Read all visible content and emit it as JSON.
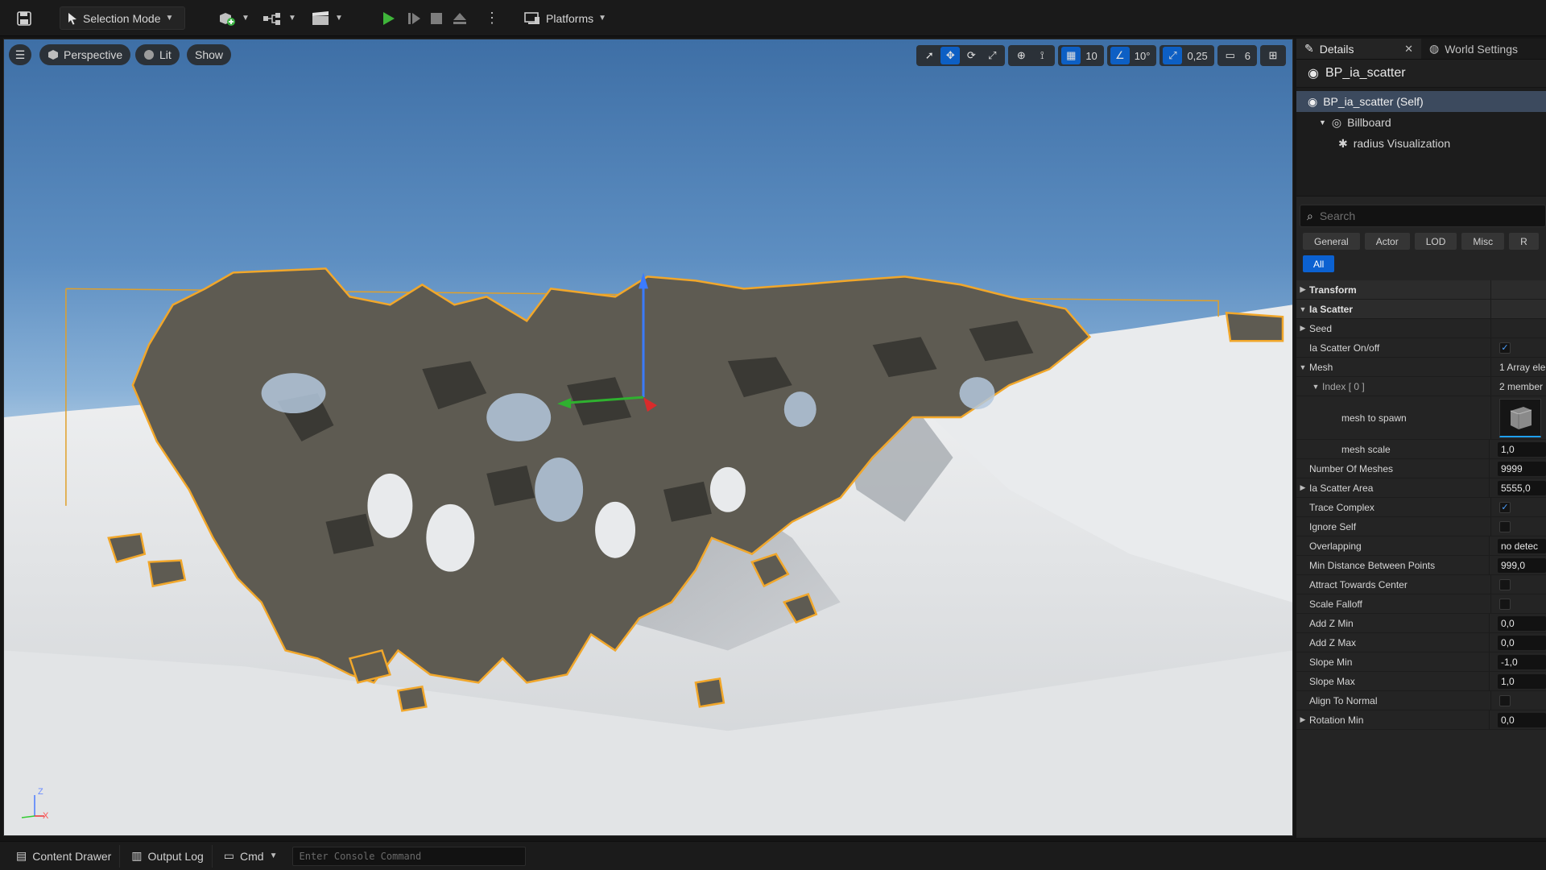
{
  "toolbar": {
    "mode_label": "Selection Mode",
    "platforms_label": "Platforms"
  },
  "viewport": {
    "perspective_label": "Perspective",
    "lit_label": "Lit",
    "show_label": "Show",
    "grid_snap": "10",
    "rotate_snap": "10°",
    "scale_snap": "0,25",
    "camera_speed": "6",
    "axis_z": "Z",
    "axis_x": "X"
  },
  "details": {
    "tab_details": "Details",
    "tab_world_settings": "World Settings",
    "actor_name": "BP_ia_scatter",
    "components": [
      {
        "label": "BP_ia_scatter (Self)"
      },
      {
        "label": "Billboard"
      },
      {
        "label": "radius Visualization"
      }
    ],
    "search_placeholder": "Search",
    "filters": [
      "General",
      "Actor",
      "LOD",
      "Misc",
      "R"
    ],
    "filter_all": "All",
    "properties": {
      "transform": "Transform",
      "ia_scatter": "Ia Scatter",
      "seed": "Seed",
      "scatter_onoff": "Ia Scatter On/off",
      "mesh": "Mesh",
      "mesh_value": "1 Array ele",
      "index0": "Index [ 0 ]",
      "index0_value": "2 member",
      "mesh_to_spawn": "mesh to spawn",
      "mesh_scale": "mesh scale",
      "mesh_scale_value": "1,0",
      "number_of_meshes": "Number Of Meshes",
      "number_of_meshes_value": "9999",
      "scatter_area": "Ia Scatter Area",
      "scatter_area_value": "5555,0",
      "trace_complex": "Trace Complex",
      "ignore_self": "Ignore Self",
      "overlapping": "Overlapping",
      "overlapping_value": "no detec",
      "min_distance": "Min Distance Between Points",
      "min_distance_value": "999,0",
      "attract_center": "Attract Towards Center",
      "scale_falloff": "Scale Falloff",
      "add_z_min": "Add Z Min",
      "add_z_min_value": "0,0",
      "add_z_max": "Add Z Max",
      "add_z_max_value": "0,0",
      "slope_min": "Slope Min",
      "slope_min_value": "-1,0",
      "slope_max": "Slope Max",
      "slope_max_value": "1,0",
      "align_normal": "Align To Normal",
      "rotation_min": "Rotation Min",
      "rotation_min_value": "0,0"
    }
  },
  "bottom": {
    "content_drawer": "Content Drawer",
    "output_log": "Output Log",
    "cmd": "Cmd",
    "console_placeholder": "Enter Console Command"
  }
}
